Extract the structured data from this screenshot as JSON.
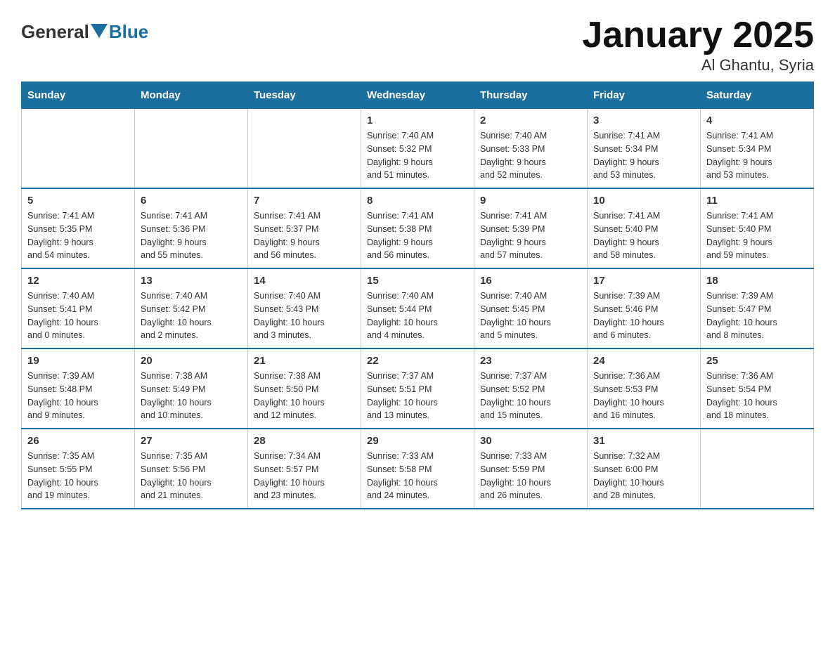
{
  "header": {
    "logo_text": "General",
    "logo_blue": "Blue",
    "title": "January 2025",
    "subtitle": "Al Ghantu, Syria"
  },
  "days_of_week": [
    "Sunday",
    "Monday",
    "Tuesday",
    "Wednesday",
    "Thursday",
    "Friday",
    "Saturday"
  ],
  "weeks": [
    [
      {
        "day": "",
        "info": ""
      },
      {
        "day": "",
        "info": ""
      },
      {
        "day": "",
        "info": ""
      },
      {
        "day": "1",
        "info": "Sunrise: 7:40 AM\nSunset: 5:32 PM\nDaylight: 9 hours\nand 51 minutes."
      },
      {
        "day": "2",
        "info": "Sunrise: 7:40 AM\nSunset: 5:33 PM\nDaylight: 9 hours\nand 52 minutes."
      },
      {
        "day": "3",
        "info": "Sunrise: 7:41 AM\nSunset: 5:34 PM\nDaylight: 9 hours\nand 53 minutes."
      },
      {
        "day": "4",
        "info": "Sunrise: 7:41 AM\nSunset: 5:34 PM\nDaylight: 9 hours\nand 53 minutes."
      }
    ],
    [
      {
        "day": "5",
        "info": "Sunrise: 7:41 AM\nSunset: 5:35 PM\nDaylight: 9 hours\nand 54 minutes."
      },
      {
        "day": "6",
        "info": "Sunrise: 7:41 AM\nSunset: 5:36 PM\nDaylight: 9 hours\nand 55 minutes."
      },
      {
        "day": "7",
        "info": "Sunrise: 7:41 AM\nSunset: 5:37 PM\nDaylight: 9 hours\nand 56 minutes."
      },
      {
        "day": "8",
        "info": "Sunrise: 7:41 AM\nSunset: 5:38 PM\nDaylight: 9 hours\nand 56 minutes."
      },
      {
        "day": "9",
        "info": "Sunrise: 7:41 AM\nSunset: 5:39 PM\nDaylight: 9 hours\nand 57 minutes."
      },
      {
        "day": "10",
        "info": "Sunrise: 7:41 AM\nSunset: 5:40 PM\nDaylight: 9 hours\nand 58 minutes."
      },
      {
        "day": "11",
        "info": "Sunrise: 7:41 AM\nSunset: 5:40 PM\nDaylight: 9 hours\nand 59 minutes."
      }
    ],
    [
      {
        "day": "12",
        "info": "Sunrise: 7:40 AM\nSunset: 5:41 PM\nDaylight: 10 hours\nand 0 minutes."
      },
      {
        "day": "13",
        "info": "Sunrise: 7:40 AM\nSunset: 5:42 PM\nDaylight: 10 hours\nand 2 minutes."
      },
      {
        "day": "14",
        "info": "Sunrise: 7:40 AM\nSunset: 5:43 PM\nDaylight: 10 hours\nand 3 minutes."
      },
      {
        "day": "15",
        "info": "Sunrise: 7:40 AM\nSunset: 5:44 PM\nDaylight: 10 hours\nand 4 minutes."
      },
      {
        "day": "16",
        "info": "Sunrise: 7:40 AM\nSunset: 5:45 PM\nDaylight: 10 hours\nand 5 minutes."
      },
      {
        "day": "17",
        "info": "Sunrise: 7:39 AM\nSunset: 5:46 PM\nDaylight: 10 hours\nand 6 minutes."
      },
      {
        "day": "18",
        "info": "Sunrise: 7:39 AM\nSunset: 5:47 PM\nDaylight: 10 hours\nand 8 minutes."
      }
    ],
    [
      {
        "day": "19",
        "info": "Sunrise: 7:39 AM\nSunset: 5:48 PM\nDaylight: 10 hours\nand 9 minutes."
      },
      {
        "day": "20",
        "info": "Sunrise: 7:38 AM\nSunset: 5:49 PM\nDaylight: 10 hours\nand 10 minutes."
      },
      {
        "day": "21",
        "info": "Sunrise: 7:38 AM\nSunset: 5:50 PM\nDaylight: 10 hours\nand 12 minutes."
      },
      {
        "day": "22",
        "info": "Sunrise: 7:37 AM\nSunset: 5:51 PM\nDaylight: 10 hours\nand 13 minutes."
      },
      {
        "day": "23",
        "info": "Sunrise: 7:37 AM\nSunset: 5:52 PM\nDaylight: 10 hours\nand 15 minutes."
      },
      {
        "day": "24",
        "info": "Sunrise: 7:36 AM\nSunset: 5:53 PM\nDaylight: 10 hours\nand 16 minutes."
      },
      {
        "day": "25",
        "info": "Sunrise: 7:36 AM\nSunset: 5:54 PM\nDaylight: 10 hours\nand 18 minutes."
      }
    ],
    [
      {
        "day": "26",
        "info": "Sunrise: 7:35 AM\nSunset: 5:55 PM\nDaylight: 10 hours\nand 19 minutes."
      },
      {
        "day": "27",
        "info": "Sunrise: 7:35 AM\nSunset: 5:56 PM\nDaylight: 10 hours\nand 21 minutes."
      },
      {
        "day": "28",
        "info": "Sunrise: 7:34 AM\nSunset: 5:57 PM\nDaylight: 10 hours\nand 23 minutes."
      },
      {
        "day": "29",
        "info": "Sunrise: 7:33 AM\nSunset: 5:58 PM\nDaylight: 10 hours\nand 24 minutes."
      },
      {
        "day": "30",
        "info": "Sunrise: 7:33 AM\nSunset: 5:59 PM\nDaylight: 10 hours\nand 26 minutes."
      },
      {
        "day": "31",
        "info": "Sunrise: 7:32 AM\nSunset: 6:00 PM\nDaylight: 10 hours\nand 28 minutes."
      },
      {
        "day": "",
        "info": ""
      }
    ]
  ]
}
